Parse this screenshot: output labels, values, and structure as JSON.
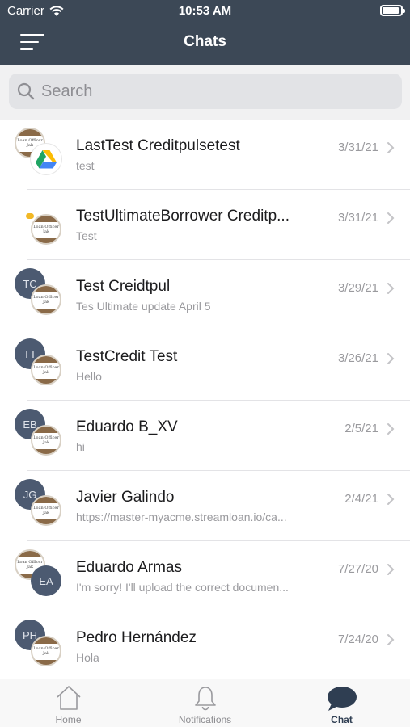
{
  "status": {
    "carrier": "Carrier",
    "time": "10:53 AM"
  },
  "header": {
    "title": "Chats"
  },
  "search": {
    "placeholder": "Search"
  },
  "chats": [
    {
      "name": "LastTest Creditpulsetest",
      "preview": "test",
      "date": "3/31/21",
      "avatar": "logo",
      "front_avatar": "drive-icon"
    },
    {
      "name": "TestUltimateBorrower Creditp...",
      "preview": "Test",
      "date": "3/31/21",
      "avatar": "yellow-dot",
      "front_avatar": "logo"
    },
    {
      "name": "Test Creidtpul",
      "preview": "Tes Ultimate  update April 5",
      "date": "3/29/21",
      "initials": "TC",
      "front_avatar": "logo"
    },
    {
      "name": "TestCredit Test",
      "preview": "Hello",
      "date": "3/26/21",
      "initials": "TT",
      "front_avatar": "logo"
    },
    {
      "name": "Eduardo B_XV",
      "preview": "hi",
      "date": "2/5/21",
      "initials": "EB",
      "front_avatar": "logo"
    },
    {
      "name": "Javier Galindo",
      "preview": "https://master-myacme.streamloan.io/ca...",
      "date": "2/4/21",
      "initials": "JG",
      "front_avatar": "logo"
    },
    {
      "name": "Eduardo Armas",
      "preview": "I'm sorry! I'll upload the correct documen...",
      "date": "7/27/20",
      "avatar": "logo",
      "front_initials": "EA"
    },
    {
      "name": "Pedro Hernández",
      "preview": "Hola",
      "date": "7/24/20",
      "initials": "PH",
      "front_avatar": "logo"
    }
  ],
  "logo": {
    "text": "Loan Officer Jak"
  },
  "tabs": [
    {
      "label": "Home",
      "icon": "home-icon"
    },
    {
      "label": "Notifications",
      "icon": "bell-icon"
    },
    {
      "label": "Chat",
      "icon": "chat-bubble-icon",
      "active": true
    }
  ],
  "colors": {
    "header": "#3c4856",
    "avatar": "#4c5a71",
    "active_tab": "#2f3e52",
    "muted": "#9a9a9e"
  }
}
